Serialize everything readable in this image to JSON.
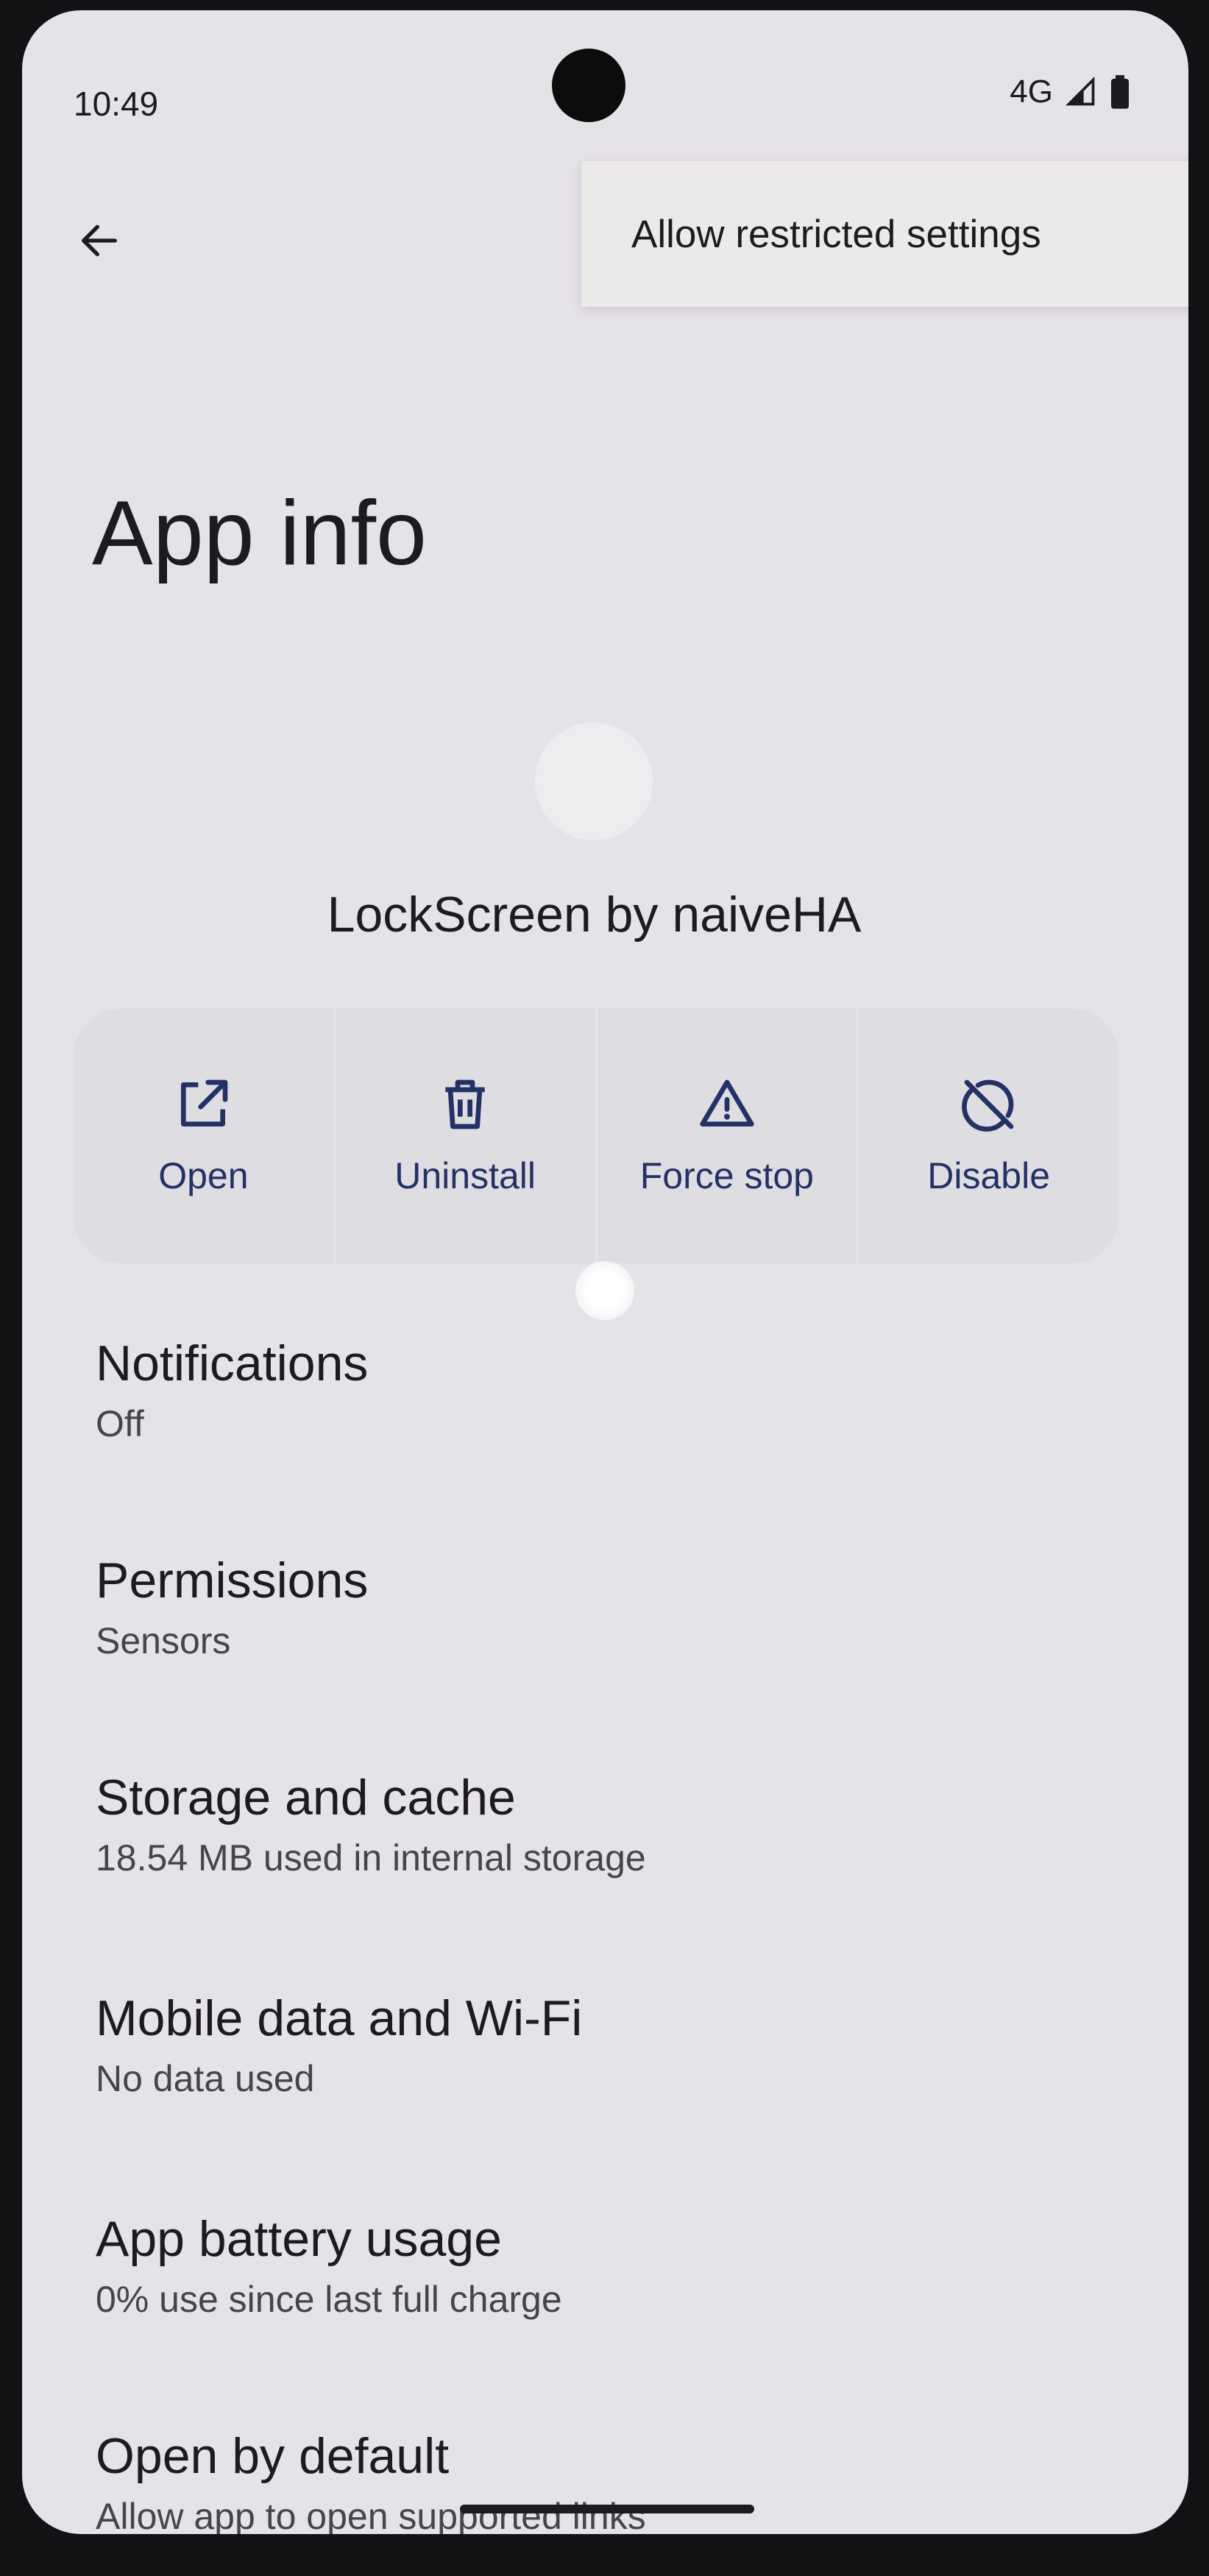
{
  "status_bar": {
    "time": "10:49",
    "network": "4G"
  },
  "toolbar": {
    "back_icon": "arrow-left-icon",
    "menu_item": "Allow restricted settings"
  },
  "page": {
    "title": "App info"
  },
  "app": {
    "name": "LockScreen by naiveHA"
  },
  "actions": [
    {
      "label": "Open",
      "icon": "open-external-icon"
    },
    {
      "label": "Uninstall",
      "icon": "trash-icon"
    },
    {
      "label": "Force stop",
      "icon": "warning-triangle-icon"
    },
    {
      "label": "Disable",
      "icon": "disable-icon"
    }
  ],
  "preferences": [
    {
      "title": "Notifications",
      "summary": "Off"
    },
    {
      "title": "Permissions",
      "summary": "Sensors"
    },
    {
      "title": "Storage and cache",
      "summary": "18.54 MB used in internal storage"
    },
    {
      "title": "Mobile data and Wi-Fi",
      "summary": "No data used"
    },
    {
      "title": "App battery usage",
      "summary": "0% use since last full charge"
    },
    {
      "title": "Open by default",
      "summary": "Allow app to open supported links"
    }
  ],
  "colors": {
    "accent": "#233266",
    "background": "#e6e3e8",
    "action_panel": "#dedde2"
  }
}
